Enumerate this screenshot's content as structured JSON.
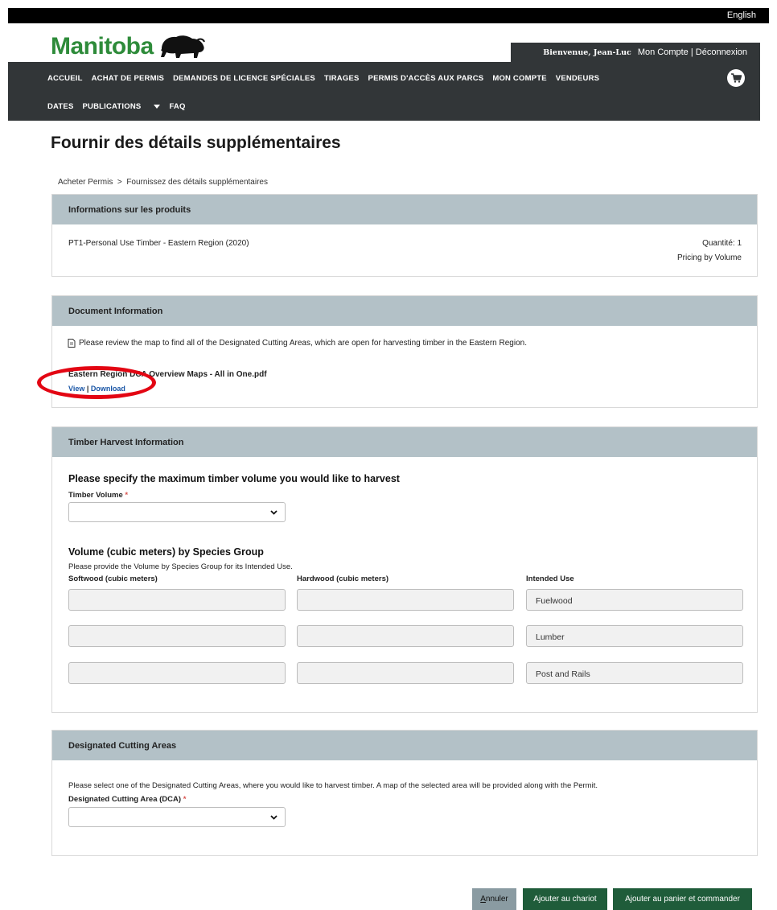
{
  "header": {
    "language_link": "English",
    "brand": "Manitoba",
    "welcome_text": "Bienvenue, Jean-Luc",
    "account_link": "Mon Compte",
    "separator": "|",
    "logout_link": "Déconnexion",
    "nav_row1": [
      "ACCUEIL",
      "ACHAT DE PERMIS",
      "DEMANDES DE LICENCE SPÉCIALES",
      "TIRAGES",
      "PERMIS D'ACCÈS AUX PARCS",
      "MON COMPTE",
      "VENDEURS"
    ],
    "nav_row2": [
      "DATES",
      "PUBLICATIONS",
      "FAQ"
    ],
    "brand_color": "#2e8b3a",
    "nav_bg": "#323638"
  },
  "page": {
    "title": "Fournir des détails supplémentaires",
    "breadcrumb": {
      "parent": "Acheter Permis",
      "sep": ">",
      "current": "Fournissez des détails supplémentaires"
    }
  },
  "product_panel": {
    "heading": "Informations sur les produits",
    "product_name": "PT1-Personal Use Timber - Eastern Region (2020)",
    "quantity": "Quantité: 1",
    "pricing": "Pricing by Volume"
  },
  "document_panel": {
    "heading": "Document Information",
    "description": "Please review the map to find all of the Designated Cutting Areas, which are open for harvesting timber in the Eastern Region.",
    "file_name": "Eastern Region DCA Overview Maps - All in One.pdf",
    "view_link": "View",
    "download_link": "Download",
    "link_sep": "|",
    "highlight_color": "#e30613"
  },
  "timber_panel": {
    "heading": "Timber Harvest Information",
    "question": "Please specify the maximum timber volume you would like to harvest",
    "volume_label": "Timber Volume",
    "required_mark": "*",
    "volume_value": "",
    "species_title": "Volume (cubic meters) by Species Group",
    "species_help": "Please provide the Volume by Species Group for its Intended Use.",
    "columns": [
      "Softwood (cubic meters)",
      "Hardwood (cubic meters)",
      "Intended Use"
    ],
    "rows": [
      {
        "softwood": "",
        "hardwood": "",
        "use": "Fuelwood"
      },
      {
        "softwood": "",
        "hardwood": "",
        "use": "Lumber"
      },
      {
        "softwood": "",
        "hardwood": "",
        "use": "Post and Rails"
      }
    ]
  },
  "dca_panel": {
    "heading": "Designated Cutting Areas",
    "description": "Please select one of the Designated Cutting Areas, where you would like to harvest timber. A map of the selected area will be provided along with the Permit.",
    "dca_label": "Designated Cutting Area (DCA)",
    "required_mark": "*",
    "dca_value": ""
  },
  "actions": {
    "cancel_label": "Annuler",
    "cancel_key": "A",
    "add_cart_label": "Ajouter au chariot",
    "add_order_label": "Ajouter au panier et commander",
    "cancel_color": "#8a9ba2",
    "primary_color": "#1f5c3a"
  },
  "icons": {
    "cart": "shopping-cart-icon",
    "doc": "document-icon",
    "chevron": "chevron-down-icon",
    "bison": "bison-logo-icon"
  }
}
